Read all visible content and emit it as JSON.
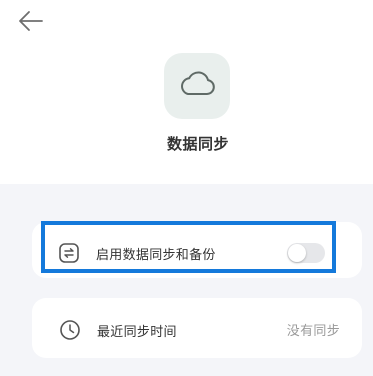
{
  "header": {
    "back_icon": "arrow-left-icon"
  },
  "hero": {
    "icon": "cloud-icon",
    "title": "数据同步"
  },
  "settings": {
    "sync_toggle": {
      "icon": "sync-arrows-icon",
      "label": "启用数据同步和备份",
      "enabled": false
    },
    "last_sync": {
      "icon": "clock-icon",
      "label": "最近同步时间",
      "value": "没有同步"
    }
  },
  "colors": {
    "highlight": "#1479db",
    "background": "#f4f5f9",
    "hero_icon_bg": "#e9efed",
    "toggle_off": "#e6e7ea"
  }
}
